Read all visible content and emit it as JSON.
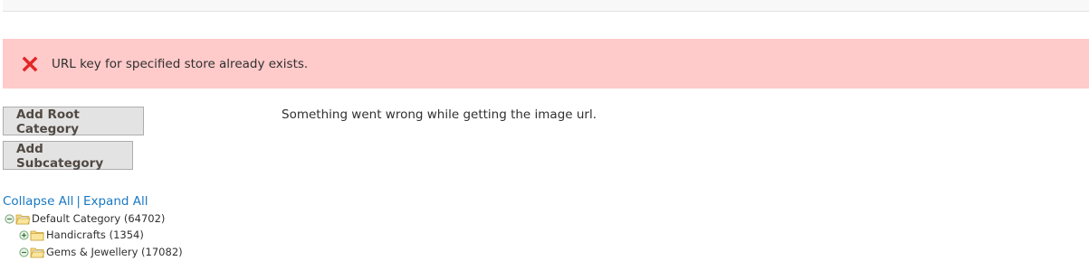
{
  "error": {
    "message": "URL key for specified store already exists."
  },
  "buttons": {
    "add_root": "Add Root Category",
    "add_sub": "Add Subcategory"
  },
  "notice": "Something went wrong while getting the image url.",
  "tree_controls": {
    "collapse_all": "Collapse All",
    "separator": "|",
    "expand_all": "Expand All"
  },
  "tree": {
    "root": {
      "label": "Default Category (64702)"
    },
    "children": [
      {
        "label": "Handicrafts (1354)"
      },
      {
        "label": "Gems & Jewellery (17082)"
      }
    ]
  },
  "colors": {
    "error_bg": "#ffcaca",
    "error_icon": "#e22626",
    "link": "#1979c3"
  }
}
